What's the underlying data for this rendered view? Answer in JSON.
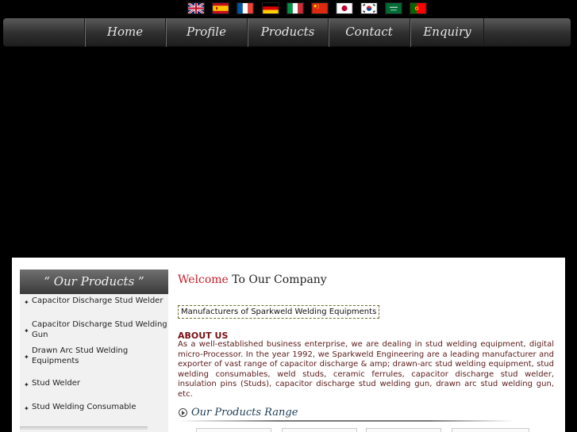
{
  "flags": [
    {
      "name": "english-flag-icon"
    },
    {
      "name": "spanish-flag-icon"
    },
    {
      "name": "french-flag-icon"
    },
    {
      "name": "german-flag-icon"
    },
    {
      "name": "italian-flag-icon"
    },
    {
      "name": "chinese-flag-icon"
    },
    {
      "name": "japanese-flag-icon"
    },
    {
      "name": "korean-flag-icon"
    },
    {
      "name": "arabic-flag-icon"
    },
    {
      "name": "portuguese-flag-icon"
    }
  ],
  "nav": {
    "home": "Home",
    "profile": "Profile",
    "products": "Products",
    "contact": "Contact",
    "enquiry": "Enquiry"
  },
  "sidebar": {
    "title": "“ Our Products ”",
    "bullet": "✦",
    "items": [
      {
        "label": "Capacitor Discharge Stud Welder"
      },
      {
        "label": "Capacitor Discharge Stud Welding Gun"
      },
      {
        "label": "Drawn Arc Stud Welding Equipments"
      },
      {
        "label": "Stud Welder"
      },
      {
        "label": "Stud Welding Consumable"
      }
    ]
  },
  "main": {
    "welcome_red": "Welcome",
    "welcome_rest": " To Our Company",
    "tagline": "Manufacturers of Sparkweld Welding Equipments",
    "about_heading": "ABOUT US",
    "about_text": "As a well-established business enterprise, we are dealing in stud welding equipment, digital micro-Processor. In the year 1992, we Sparkweld Engineering are a leading manufacturer and exporter of vast range of capacitor discharge & amp; drawn-arc stud welding equipment, stud welding consumables, weld studs, ceramic ferrules, capacitor discharge stud welder, insulation pins (Studs), capacitor discharge stud welding gun, drawn arc stud welding gun, etc.",
    "range_title": "Our Products Range"
  },
  "colors": {
    "accent_red": "#c8202a",
    "heading_maroon": "#7a0f14",
    "range_blue": "#1e3c56"
  }
}
